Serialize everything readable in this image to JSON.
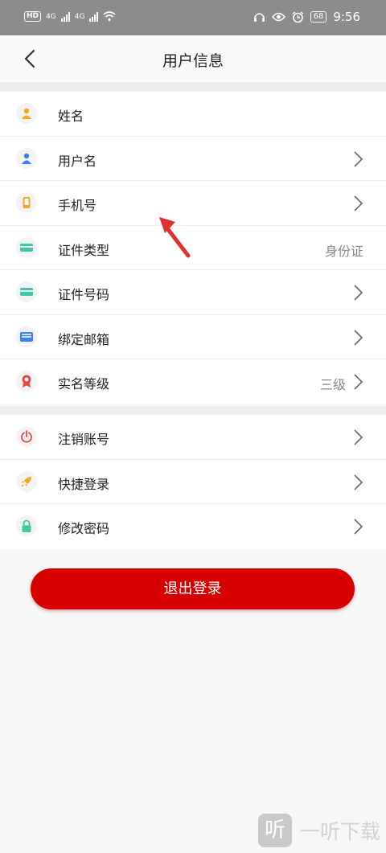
{
  "status_bar": {
    "network_badge": "HD",
    "network_type_1": "4G",
    "network_type_2": "4G",
    "battery": "68",
    "time": "9:56"
  },
  "header": {
    "title": "用户信息",
    "back_icon": "chevron-left-icon"
  },
  "info_rows": [
    {
      "label": "姓名",
      "value": "",
      "icon": "person-orange-icon",
      "icon_color": "#f5a623",
      "has_chevron": false
    },
    {
      "label": "用户名",
      "value": "",
      "icon": "person-blue-icon",
      "icon_color": "#3d7ff0",
      "has_chevron": true
    },
    {
      "label": "手机号",
      "value": "",
      "icon": "phone-icon",
      "icon_color": "#f5a623",
      "has_chevron": true
    },
    {
      "label": "证件类型",
      "value": "身份证",
      "icon": "id-card-icon",
      "icon_color": "#3cc9a8",
      "has_chevron": false
    },
    {
      "label": "证件号码",
      "value": "",
      "icon": "id-card-icon",
      "icon_color": "#3cc9a8",
      "has_chevron": true
    },
    {
      "label": "绑定邮箱",
      "value": "",
      "icon": "mail-icon",
      "icon_color": "#3d7ff0",
      "has_chevron": true
    },
    {
      "label": "实名等级",
      "value": "三级",
      "icon": "award-icon",
      "icon_color": "#e8464a",
      "has_chevron": true
    }
  ],
  "action_rows": [
    {
      "label": "注销账号",
      "icon": "power-icon",
      "icon_color": "#e8464a"
    },
    {
      "label": "快捷登录",
      "icon": "rocket-icon",
      "icon_color": "#f5a623"
    },
    {
      "label": "修改密码",
      "icon": "lock-icon",
      "icon_color": "#3cc9a8"
    }
  ],
  "logout_label": "退出登录",
  "watermark": {
    "logo": "听",
    "text": "一听下载"
  },
  "colors": {
    "accent": "#d60000",
    "annotation_arrow": "#e03030"
  }
}
